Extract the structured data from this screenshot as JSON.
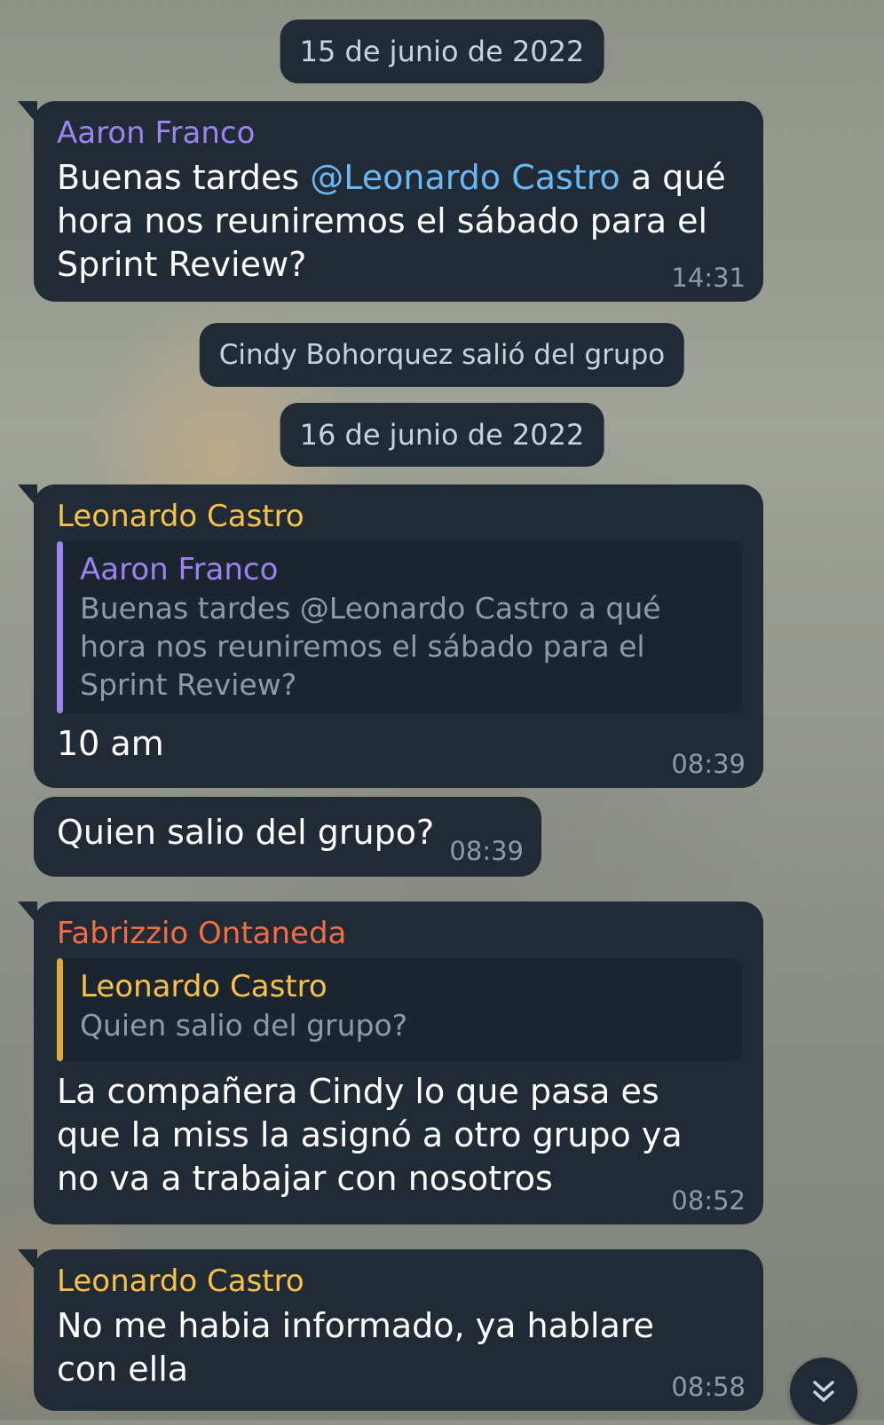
{
  "colors": {
    "bubble_bg": "#202b36",
    "accent_aaron": "#9c83f1",
    "accent_leonardo": "#f8c24a",
    "accent_fabrizzio": "#f26c44",
    "mention": "#6ab7f5",
    "time": "#8e9aa6"
  },
  "chat": {
    "date_1": "15 de junio de 2022",
    "service_left": "Cindy Bohorquez salió del grupo",
    "date_2": "16 de junio de 2022",
    "messages": [
      {
        "sender": "Aaron Franco",
        "text_before": "Buenas tardes ",
        "mention": "@Leonardo Castro",
        "text_after": " a qué hora nos reuniremos el sábado para el Sprint Review?",
        "time": "14:31"
      },
      {
        "sender": "Leonardo Castro",
        "reply_sender": "Aaron Franco",
        "reply_text": "Buenas tardes @Leonardo Castro a qué hora nos reuniremos el sábado para el Sprint Review?",
        "text": "10 am",
        "time": "08:39"
      },
      {
        "text": "Quien salio del grupo?",
        "time": "08:39"
      },
      {
        "sender": "Fabrizzio Ontaneda",
        "reply_sender": "Leonardo Castro",
        "reply_text": "Quien salio del grupo?",
        "text": "La compañera Cindy lo que pasa es que la miss la asignó a otro grupo ya no va a trabajar con nosotros",
        "time": "08:52"
      },
      {
        "sender": "Leonardo Castro",
        "text": "No me habia informado, ya hablare con ella",
        "time": "08:58"
      }
    ]
  },
  "scroll_down_icon": "double-chevron-down-icon"
}
